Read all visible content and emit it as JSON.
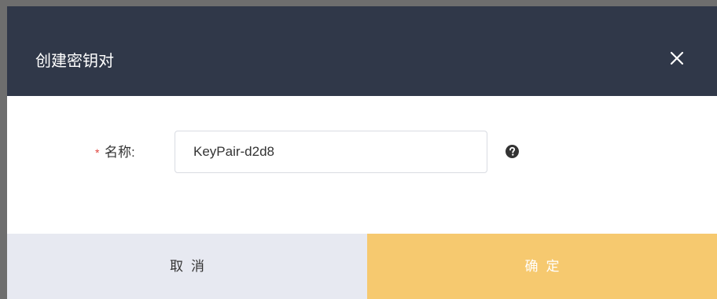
{
  "dialog": {
    "title": "创建密钥对",
    "close_icon": "close-icon"
  },
  "form": {
    "required_mark": "*",
    "name_label": "名称:",
    "name_value": "KeyPair-d2d8",
    "help_icon": "help-icon"
  },
  "footer": {
    "cancel_label": "取消",
    "confirm_label": "确定"
  },
  "colors": {
    "header_bg": "#303849",
    "cancel_bg": "#e7e9f1",
    "confirm_bg": "#f6c96f",
    "required": "#e0443d"
  }
}
